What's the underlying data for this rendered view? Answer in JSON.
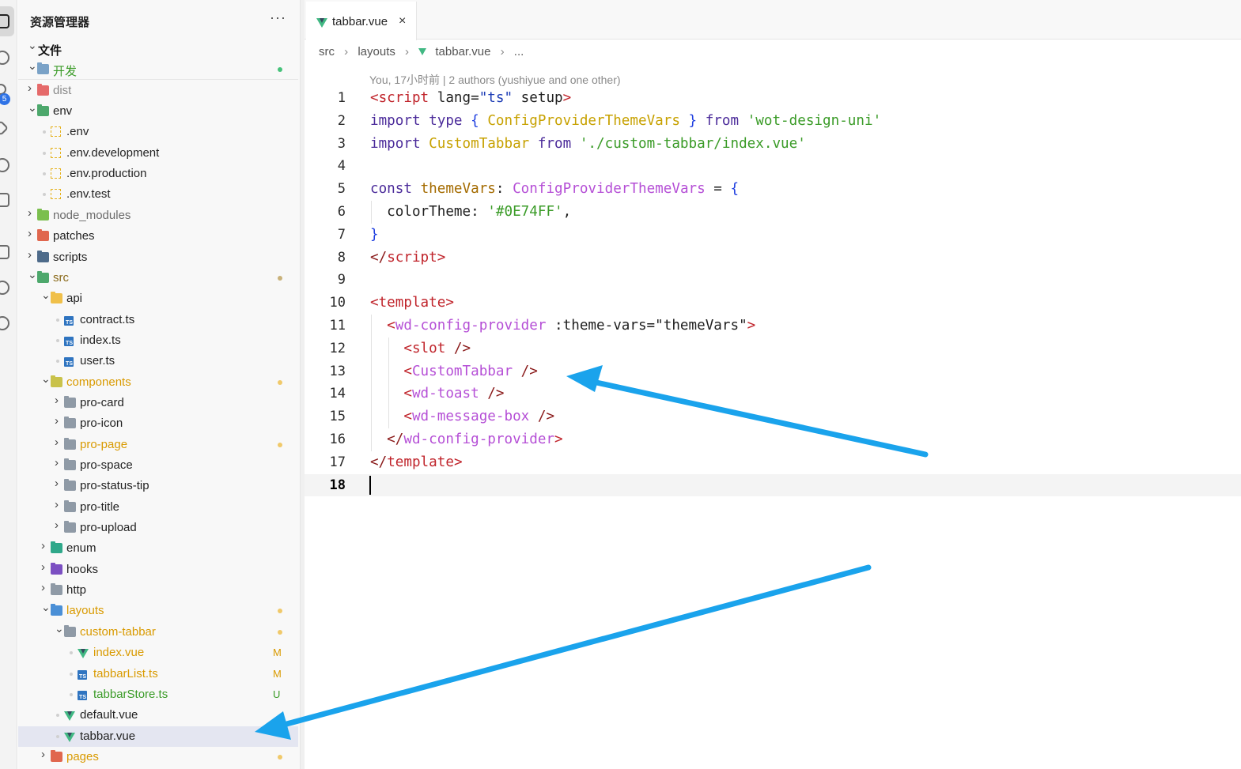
{
  "sidebar": {
    "title": "资源管理器",
    "more": "···",
    "rows": [
      {
        "label": "文件",
        "depth": 0,
        "kind": "section",
        "open": true,
        "color": "#111111",
        "bold": true
      },
      {
        "label": "开发",
        "depth": 0,
        "kind": "folder",
        "open": true,
        "color": "#3a9b27",
        "icon_color": "#7aa2c7",
        "status": "dot",
        "status_color": "#46c27a"
      },
      {
        "label": "dist",
        "depth": 0,
        "kind": "folder",
        "open": false,
        "color": "#8a8a8a",
        "icon_color": "#e56a6a"
      },
      {
        "label": "env",
        "depth": 0,
        "kind": "folder",
        "open": true,
        "color": "#222222",
        "icon_color": "#4da86c"
      },
      {
        "label": ".env",
        "depth": 1,
        "kind": "env",
        "color": "#222222"
      },
      {
        "label": ".env.development",
        "depth": 1,
        "kind": "env",
        "color": "#222222"
      },
      {
        "label": ".env.production",
        "depth": 1,
        "kind": "env",
        "color": "#222222"
      },
      {
        "label": ".env.test",
        "depth": 1,
        "kind": "env",
        "color": "#222222"
      },
      {
        "label": "node_modules",
        "depth": 0,
        "kind": "folder",
        "open": false,
        "color": "#6b6b6b",
        "icon_color": "#7bbf4e"
      },
      {
        "label": "patches",
        "depth": 0,
        "kind": "folder",
        "open": false,
        "color": "#222222",
        "icon_color": "#e0674e"
      },
      {
        "label": "scripts",
        "depth": 0,
        "kind": "folder",
        "open": false,
        "color": "#222222",
        "icon_color": "#4e6b8a"
      },
      {
        "label": "src",
        "depth": 0,
        "kind": "folder",
        "open": true,
        "color": "#8a6a1a",
        "icon_color": "#4da86c",
        "status": "dot",
        "status_color": "#c9b27a"
      },
      {
        "label": "api",
        "depth": 1,
        "kind": "folder",
        "open": true,
        "color": "#222222",
        "icon_color": "#f0c04a"
      },
      {
        "label": "contract.ts",
        "depth": 2,
        "kind": "ts",
        "color": "#222222"
      },
      {
        "label": "index.ts",
        "depth": 2,
        "kind": "ts",
        "color": "#222222"
      },
      {
        "label": "user.ts",
        "depth": 2,
        "kind": "ts",
        "color": "#222222"
      },
      {
        "label": "components",
        "depth": 1,
        "kind": "folder",
        "open": true,
        "color": "#d99a00",
        "icon_color": "#c9c24a",
        "status": "dot",
        "status_color": "#f0c96a"
      },
      {
        "label": "pro-card",
        "depth": 2,
        "kind": "folder",
        "open": false,
        "color": "#222222",
        "icon_color": "#8f9aa6"
      },
      {
        "label": "pro-icon",
        "depth": 2,
        "kind": "folder",
        "open": false,
        "color": "#222222",
        "icon_color": "#8f9aa6"
      },
      {
        "label": "pro-page",
        "depth": 2,
        "kind": "folder",
        "open": false,
        "color": "#d99a00",
        "icon_color": "#8f9aa6",
        "status": "dot",
        "status_color": "#f0c96a"
      },
      {
        "label": "pro-space",
        "depth": 2,
        "kind": "folder",
        "open": false,
        "color": "#222222",
        "icon_color": "#8f9aa6"
      },
      {
        "label": "pro-status-tip",
        "depth": 2,
        "kind": "folder",
        "open": false,
        "color": "#222222",
        "icon_color": "#8f9aa6"
      },
      {
        "label": "pro-title",
        "depth": 2,
        "kind": "folder",
        "open": false,
        "color": "#222222",
        "icon_color": "#8f9aa6"
      },
      {
        "label": "pro-upload",
        "depth": 2,
        "kind": "folder",
        "open": false,
        "color": "#222222",
        "icon_color": "#8f9aa6"
      },
      {
        "label": "enum",
        "depth": 1,
        "kind": "folder",
        "open": false,
        "color": "#222222",
        "icon_color": "#2fa88a"
      },
      {
        "label": "hooks",
        "depth": 1,
        "kind": "folder",
        "open": false,
        "color": "#222222",
        "icon_color": "#7b4fc2"
      },
      {
        "label": "http",
        "depth": 1,
        "kind": "folder",
        "open": false,
        "color": "#222222",
        "icon_color": "#8f9aa6"
      },
      {
        "label": "layouts",
        "depth": 1,
        "kind": "folder",
        "open": true,
        "color": "#d99a00",
        "icon_color": "#4a8fd6",
        "status": "dot",
        "status_color": "#f0c96a"
      },
      {
        "label": "custom-tabbar",
        "depth": 2,
        "kind": "folder",
        "open": true,
        "color": "#d99a00",
        "icon_color": "#8f9aa6",
        "status": "dot",
        "status_color": "#f0c96a"
      },
      {
        "label": "index.vue",
        "depth": 3,
        "kind": "vue",
        "color": "#d99a00",
        "status": "letter",
        "status_text": "M",
        "status_color": "#d99a00"
      },
      {
        "label": "tabbarList.ts",
        "depth": 3,
        "kind": "ts",
        "color": "#d99a00",
        "status": "letter",
        "status_text": "M",
        "status_color": "#d99a00"
      },
      {
        "label": "tabbarStore.ts",
        "depth": 3,
        "kind": "ts",
        "color": "#3a9b27",
        "status": "letter",
        "status_text": "U",
        "status_color": "#3a9b27"
      },
      {
        "label": "default.vue",
        "depth": 2,
        "kind": "vue",
        "color": "#222222"
      },
      {
        "label": "tabbar.vue",
        "depth": 2,
        "kind": "vue",
        "color": "#222222",
        "selected": true
      },
      {
        "label": "pages",
        "depth": 1,
        "kind": "folder",
        "open": false,
        "color": "#d99a00",
        "icon_color": "#e0674e",
        "status": "dot",
        "status_color": "#f0c96a"
      }
    ]
  },
  "editor": {
    "tab": {
      "label": "tabbar.vue",
      "close": "×"
    },
    "breadcrumb": [
      "src",
      "layouts",
      "tabbar.vue",
      "..."
    ],
    "codelens": "You, 17小时前 | 2 authors (yushiyue and one other)",
    "current_line": 18,
    "lines": [
      {
        "n": "1",
        "tokens": [
          [
            "<",
            "t-tag"
          ],
          [
            "script",
            "t-tag"
          ],
          [
            " lang=",
            "t-attr"
          ],
          [
            "\"ts\"",
            "t-strb"
          ],
          [
            " setup",
            "t-attr"
          ],
          [
            ">",
            "t-tag"
          ]
        ]
      },
      {
        "n": "2",
        "tokens": [
          [
            "import",
            "t-kw"
          ],
          [
            " type ",
            "t-kw"
          ],
          [
            "{ ",
            "t-punct"
          ],
          [
            "ConfigProviderThemeVars",
            "t-type"
          ],
          [
            " }",
            "t-punct"
          ],
          [
            " from ",
            "t-kw"
          ],
          [
            "'wot-design-uni'",
            "t-str"
          ]
        ]
      },
      {
        "n": "3",
        "tokens": [
          [
            "import",
            "t-kw"
          ],
          [
            " ",
            "t-attr"
          ],
          [
            "CustomTabbar",
            "t-type"
          ],
          [
            " from ",
            "t-kw"
          ],
          [
            "'./custom-tabbar/index.vue'",
            "t-str"
          ]
        ]
      },
      {
        "n": "4",
        "tokens": []
      },
      {
        "n": "5",
        "tokens": [
          [
            "const",
            "t-kw"
          ],
          [
            " ",
            "t-attr"
          ],
          [
            "themeVars",
            "t-var"
          ],
          [
            ": ",
            "t-attr"
          ],
          [
            "ConfigProviderThemeVars",
            "t-typeb"
          ],
          [
            " = ",
            "t-attr"
          ],
          [
            "{",
            "t-punct"
          ]
        ]
      },
      {
        "n": "6",
        "tokens": [
          [
            "  colorTheme",
            "t-prop"
          ],
          [
            ": ",
            "t-attr"
          ],
          [
            "'#0E74FF'",
            "t-str"
          ],
          [
            ",",
            "t-attr"
          ]
        ],
        "guides": 1
      },
      {
        "n": "7",
        "tokens": [
          [
            "}",
            "t-punct"
          ]
        ]
      },
      {
        "n": "8",
        "tokens": [
          [
            "</",
            "t-brk"
          ],
          [
            "script",
            "t-tag"
          ],
          [
            ">",
            "t-tag"
          ]
        ]
      },
      {
        "n": "9",
        "tokens": []
      },
      {
        "n": "10",
        "tokens": [
          [
            "<",
            "t-tag"
          ],
          [
            "template",
            "t-tag"
          ],
          [
            ">",
            "t-tag"
          ]
        ]
      },
      {
        "n": "11",
        "tokens": [
          [
            "  <",
            "t-tag"
          ],
          [
            "wd-config-provider",
            "t-comp"
          ],
          [
            " :theme-vars=\"themeVars\"",
            "t-attr"
          ],
          [
            ">",
            "t-tag"
          ]
        ],
        "guides": 1
      },
      {
        "n": "12",
        "tokens": [
          [
            "    <",
            "t-tag"
          ],
          [
            "slot",
            "t-tag"
          ],
          [
            " />",
            "t-brk"
          ]
        ],
        "guides": 2
      },
      {
        "n": "13",
        "tokens": [
          [
            "    <",
            "t-tag"
          ],
          [
            "CustomTabbar",
            "t-comp"
          ],
          [
            " />",
            "t-brk"
          ]
        ],
        "guides": 2
      },
      {
        "n": "14",
        "tokens": [
          [
            "    <",
            "t-tag"
          ],
          [
            "wd-toast",
            "t-comp"
          ],
          [
            " />",
            "t-brk"
          ]
        ],
        "guides": 2
      },
      {
        "n": "15",
        "tokens": [
          [
            "    <",
            "t-tag"
          ],
          [
            "wd-message-box",
            "t-comp"
          ],
          [
            " />",
            "t-brk"
          ]
        ],
        "guides": 2
      },
      {
        "n": "16",
        "tokens": [
          [
            "  </",
            "t-brk"
          ],
          [
            "wd-config-provider",
            "t-comp"
          ],
          [
            ">",
            "t-tag"
          ]
        ],
        "guides": 1
      },
      {
        "n": "17",
        "tokens": [
          [
            "</",
            "t-brk"
          ],
          [
            "template",
            "t-tag"
          ],
          [
            ">",
            "t-tag"
          ]
        ]
      },
      {
        "n": "18",
        "tokens": []
      }
    ]
  },
  "colors": {
    "arrow": "#1aa3ec",
    "accent": "#2f73e6",
    "scm_badge": "5"
  }
}
